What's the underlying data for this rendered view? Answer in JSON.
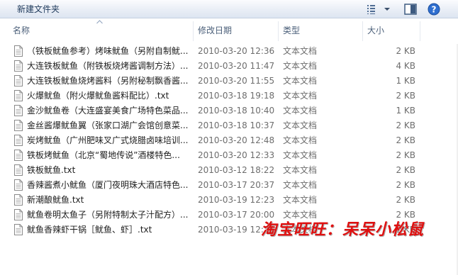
{
  "toolbar": {
    "new_folder_label": "新建文件夹"
  },
  "columns": {
    "name": "名称",
    "date": "修改日期",
    "type": "类型",
    "size": "大小"
  },
  "files": [
    {
      "name": "（铁板鱿鱼参考）烤味鱿鱼（另附自制鱿...",
      "date": "2010-03-20 12:36",
      "type": "文本文档",
      "size": "2 KB"
    },
    {
      "name": "大连铁板鱿鱼（附铁板烧烤酱调制方法）...",
      "date": "2010-03-20 11:47",
      "type": "文本文档",
      "size": "4 KB"
    },
    {
      "name": "大连铁板鱿鱼烧烤酱料（另附秘制飘香酱...",
      "date": "2010-03-20 11:55",
      "type": "文本文档",
      "size": "1 KB"
    },
    {
      "name": "火爆鱿鱼（附火爆鱿鱼酱料配比）.txt",
      "date": "2010-03-18 19:18",
      "type": "文本文档",
      "size": "2 KB"
    },
    {
      "name": "金沙鱿鱼卷（大连盛宴美食广场特色菜品...",
      "date": "2010-03-18 10:40",
      "type": "文本文档",
      "size": "1 KB"
    },
    {
      "name": "金丝酱爆鱿鱼翼（张家口湖广会馆创意菜...",
      "date": "2010-03-18 10:37",
      "type": "文本文档",
      "size": "2 KB"
    },
    {
      "name": "炭烤鱿鱼（广州肥味叉广式烧腊卤味培训...",
      "date": "2010-03-20 12:48",
      "type": "文本文档",
      "size": "2 KB"
    },
    {
      "name": "铁板烤鱿鱼（北京“蜀地传说”酒楼特色...",
      "date": "2010-03-20 12:33",
      "type": "文本文档",
      "size": "2 KB"
    },
    {
      "name": "铁板鱿鱼.txt",
      "date": "2010-03-12 18:22",
      "type": "文本文档",
      "size": "2 KB"
    },
    {
      "name": "香辣酱煮小鱿鱼（厦门夜明珠大酒店特色...",
      "date": "2010-03-17 20:37",
      "type": "文本文档",
      "size": "2 KB"
    },
    {
      "name": "新潮酿鱿鱼.txt",
      "date": "2010-03-19 12:23",
      "type": "文本文档",
      "size": "2 KB"
    },
    {
      "name": "鱿鱼卷明太鱼子（另附特制太子汁配方）...",
      "date": "2010-03-17 20:00",
      "type": "文本文档",
      "size": "2 KB"
    },
    {
      "name": "鱿鱼香辣虾干锅［鱿鱼、虾］.txt",
      "date": "2010-03-19 12:25",
      "type": "文本文档",
      "size": "2 KB"
    }
  ],
  "watermark": "淘宝旺旺：呆呆小松鼠",
  "colors": {
    "toolbar_text": "#1e395b",
    "header_text": "#4c607a",
    "meta_text": "#6d6d6d",
    "watermark": "#e01010"
  },
  "icons": [
    "view-options-icon",
    "chevron-down-icon",
    "preview-pane-icon",
    "help-icon",
    "sort-ascending-icon",
    "text-document-icon"
  ]
}
